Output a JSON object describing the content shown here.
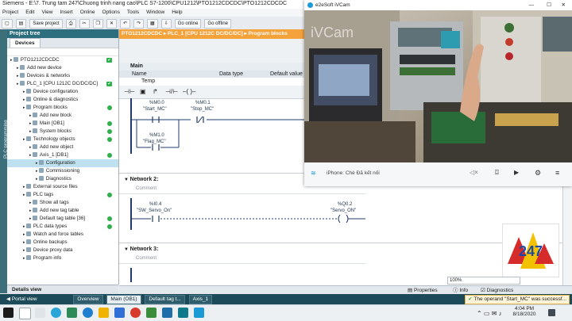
{
  "window": {
    "title": "Siemens - E:\\7. Trung tam 247\\Chuong trinh nang cao\\PLC S7-1200\\CPU1212\\PTO1212CDCDC\\PTO1212CDCDC"
  },
  "menu": [
    "Project",
    "Edit",
    "View",
    "Insert",
    "Online",
    "Options",
    "Tools",
    "Window",
    "Help"
  ],
  "toolbar": {
    "save_label": "Save project",
    "go_online": "Go online",
    "go_offline": "Go offline"
  },
  "project_tree": {
    "title": "Project tree",
    "devices_tab": "Devices",
    "vertical_label": "PLC programming",
    "items": [
      {
        "label": "PTO1212CDCDC",
        "indent": 0,
        "status": "check"
      },
      {
        "label": "Add new device",
        "indent": 1
      },
      {
        "label": "Devices & networks",
        "indent": 1
      },
      {
        "label": "PLC_1 [CPU 1212C DC/DC/DC]",
        "indent": 1,
        "status": "check"
      },
      {
        "label": "Device configuration",
        "indent": 2
      },
      {
        "label": "Online & diagnostics",
        "indent": 2
      },
      {
        "label": "Program blocks",
        "indent": 2,
        "status": "dot"
      },
      {
        "label": "Add new block",
        "indent": 3
      },
      {
        "label": "Main [OB1]",
        "indent": 3,
        "status": "dot"
      },
      {
        "label": "System blocks",
        "indent": 3,
        "status": "dot"
      },
      {
        "label": "Technology objects",
        "indent": 2,
        "status": "dot"
      },
      {
        "label": "Add new object",
        "indent": 3
      },
      {
        "label": "Axis_1 [DB1]",
        "indent": 3,
        "status": "dot"
      },
      {
        "label": "Configuration",
        "indent": 4,
        "selected": true
      },
      {
        "label": "Commissioning",
        "indent": 4
      },
      {
        "label": "Diagnostics",
        "indent": 4
      },
      {
        "label": "External source files",
        "indent": 2
      },
      {
        "label": "PLC tags",
        "indent": 2,
        "status": "dot"
      },
      {
        "label": "Show all tags",
        "indent": 3
      },
      {
        "label": "Add new tag table",
        "indent": 3
      },
      {
        "label": "Default tag table [36]",
        "indent": 3,
        "status": "dot"
      },
      {
        "label": "PLC data types",
        "indent": 2,
        "status": "dot"
      },
      {
        "label": "Watch and force tables",
        "indent": 2
      },
      {
        "label": "Online backups",
        "indent": 2
      },
      {
        "label": "Device proxy data",
        "indent": 2
      },
      {
        "label": "Program info",
        "indent": 2
      }
    ],
    "details_view": "Details view"
  },
  "editor": {
    "breadcrumb": "PTO1212CDCDC  ▸  PLC_1 [CPU 1212C DC/DC/DC]  ▸  Program blocks",
    "block_title": "Main",
    "columns": [
      "Name",
      "Data type",
      "Default value"
    ],
    "interface_row": "Temp",
    "networks": [
      {
        "title": "",
        "contacts": [
          {
            "addr": "%M0.0",
            "tag": "\"Start_MC\""
          },
          {
            "addr": "%M0.1",
            "tag": "\"Stop_MC\""
          },
          {
            "addr": "%M1.0",
            "tag": "\"Flag_MC\""
          }
        ]
      },
      {
        "title": "Network 2:",
        "comment": "Comment",
        "contact": {
          "addr": "%I0.4",
          "tag": "\"SW_Servo_On\""
        },
        "coil": {
          "addr": "%Q0.2",
          "tag": "\"Servo_ON\""
        }
      },
      {
        "title": "Network 3:",
        "comment": "Comment"
      }
    ],
    "zoom": "100%"
  },
  "inspector_tabs": [
    "Properties",
    "Info",
    "Diagnostics"
  ],
  "portal": {
    "label": "Portal view",
    "tabs": [
      "Overview",
      "Main (OB1)",
      "Default tag t...",
      "Axis_1"
    ],
    "message": "The operand \"Start_MC\" was successf..."
  },
  "camera": {
    "title": "e2eSoft iVCam",
    "watermark": "iVCam",
    "device": "iPhone: Chè Đã kết nối"
  },
  "taskbar": {
    "time": "4:04 PM",
    "date": "8/18/2020"
  },
  "colors": {
    "accent": "#2c6e7e",
    "breadcrumb": "#f4a23b",
    "status_green": "#2fb04a"
  }
}
